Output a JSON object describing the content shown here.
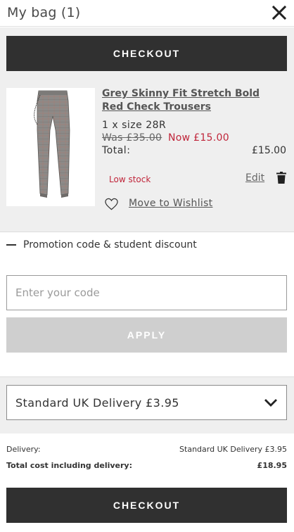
{
  "header": {
    "title": "My bag (1)",
    "close_icon": "close-icon"
  },
  "checkout_label": "CHECKOUT",
  "item": {
    "title": "Grey Skinny Fit Stretch Bold Red Check Trousers",
    "size": "1 x size 28R",
    "was_price": "Was £35.00",
    "now_price": "Now £15.00",
    "total_label": "Total:",
    "total_value": "£15.00",
    "stock": "Low stock",
    "edit_label": "Edit",
    "wishlist_label": "Move to Wishlist",
    "icons": {
      "trash": "trash-icon",
      "heart": "heart-icon"
    }
  },
  "promo": {
    "toggle_label": "Promotion code & student discount",
    "input_placeholder": "Enter your code",
    "apply_label": "APPLY"
  },
  "delivery": {
    "selected": "Standard UK Delivery £3.95"
  },
  "summary": {
    "delivery_label": "Delivery:",
    "delivery_value": "Standard UK Delivery £3.95",
    "total_label": "Total cost including delivery:",
    "total_value": "£18.95"
  },
  "colors": {
    "accent_dark": "#303030",
    "price_red": "#c0253a",
    "apply_disabled": "#cfcfcf"
  }
}
